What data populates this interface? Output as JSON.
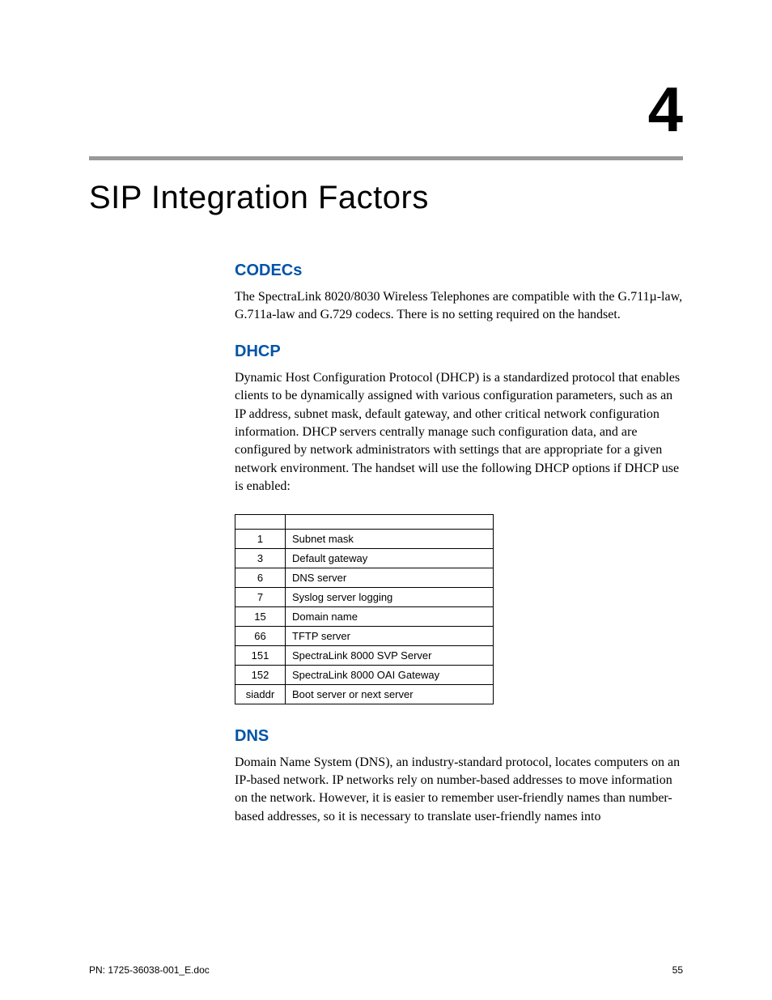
{
  "chapter_number": "4",
  "chapter_title": "SIP Integration Factors",
  "sections": {
    "codecs": {
      "heading": "CODECs",
      "text": "The SpectraLink 8020/8030 Wireless Telephones are compatible with the G.711µ-law, G.711a-law and G.729 codecs. There is no setting required on the handset."
    },
    "dhcp": {
      "heading": "DHCP",
      "text": "Dynamic Host Configuration Protocol (DHCP) is a standardized protocol that enables clients to be dynamically assigned with various configuration parameters, such as an IP address, subnet mask, default gateway, and other critical network configuration information. DHCP servers centrally manage such configuration data, and are configured by network administrators with settings that are appropriate for a given network environment. The handset will use the following DHCP options if DHCP use is enabled:",
      "table_rows": [
        {
          "option": "1",
          "desc": "Subnet mask"
        },
        {
          "option": "3",
          "desc": "Default gateway"
        },
        {
          "option": "6",
          "desc": "DNS server"
        },
        {
          "option": "7",
          "desc": "Syslog server logging"
        },
        {
          "option": "15",
          "desc": "Domain name"
        },
        {
          "option": "66",
          "desc": "TFTP server"
        },
        {
          "option": "151",
          "desc": "SpectraLink 8000 SVP Server"
        },
        {
          "option": "152",
          "desc": "SpectraLink 8000 OAI Gateway"
        },
        {
          "option": "siaddr",
          "desc": "Boot server or next server"
        }
      ]
    },
    "dns": {
      "heading": "DNS",
      "text": "Domain Name System (DNS), an industry-standard protocol, locates computers on an IP-based network. IP networks rely on number-based addresses to move information on the network. However, it is easier to remember user-friendly names than number-based addresses, so it is necessary to translate user-friendly names into"
    }
  },
  "footer": {
    "doc_id": "PN: 1725-36038-001_E.doc",
    "page_number": "55"
  }
}
